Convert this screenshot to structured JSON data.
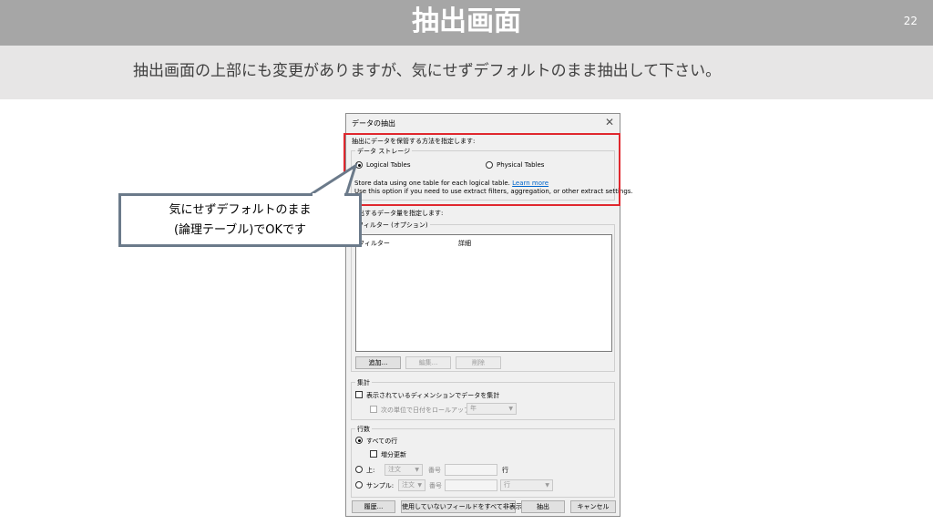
{
  "slide": {
    "title": "抽出画面",
    "page_number": "22",
    "subtitle": "抽出画面の上部にも変更がありますが、気にせずデフォルトのまま抽出して下さい。"
  },
  "dialog": {
    "title": "データの抽出",
    "close_glyph": "✕",
    "storage_prompt": "抽出にデータを保管する方法を指定します:",
    "storage_group": "データ ストレージ",
    "logical_tables": "Logical Tables",
    "physical_tables": "Physical Tables",
    "desc_line1": "Store data using one table for each logical table.",
    "learn_more": "Learn more",
    "desc_line2": "Use this option if you need to use extract filters, aggregation, or other extract settings.",
    "data_prompt": "抽出するデータ量を指定します:",
    "filter_group": "フィルター (オプション)",
    "filter_columns": [
      "フィルター",
      "詳細"
    ],
    "add_button": "追加...",
    "edit_button": "編集...",
    "remove_button": "削除",
    "aggregation_group": "集計",
    "aggregate_check": "表示されているディメンションでデータを集計",
    "rollup_check": "次の単位で日付をロールアップ",
    "rollup_value": "年",
    "rows_group": "行数",
    "all_rows": "すべての行",
    "incremental": "増分更新",
    "top_label": "上:",
    "top_order": "注文",
    "top_field_label": "番号",
    "top_unit": "行",
    "sample_label": "サンプル:",
    "sample_order": "注文",
    "sample_field_label": "番号",
    "sample_unit": "行",
    "history_button": "履歴...",
    "hide_fields_button": "使用していないフィールドをすべて非表示",
    "extract_button": "抽出",
    "cancel_button": "キャンセル"
  },
  "callout": {
    "line1": "気にせずデフォルトのまま",
    "line2": "(論理テーブル)でOKです"
  },
  "colors": {
    "title_bar": "#a6a6a6",
    "subtitle_bar": "#e7e6e6",
    "highlight": "#e0282e",
    "callout_border": "#6b7a8a"
  }
}
